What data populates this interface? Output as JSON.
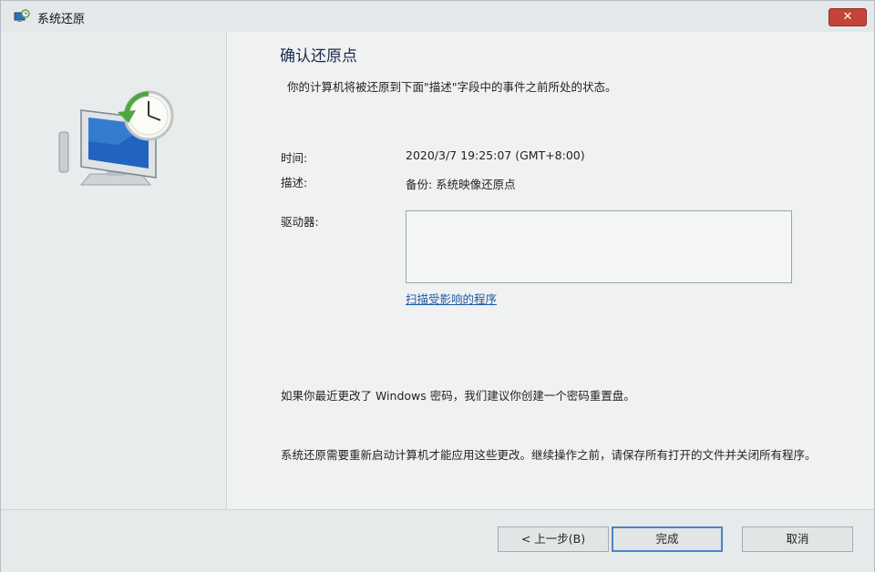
{
  "window": {
    "title": "系统还原",
    "close_label": "✕"
  },
  "main": {
    "heading": "确认还原点",
    "intro": "你的计算机将被还原到下面\"描述\"字段中的事件之前所处的状态。",
    "time_label": "时间:",
    "time_value": "2020/3/7 19:25:07 (GMT+8:00)",
    "description_label": "描述:",
    "description_value": "备份: 系统映像还原点",
    "drives_label": "驱动器:",
    "scan_link": "扫描受影响的程序",
    "password_note": "如果你最近更改了 Windows 密码，我们建议你创建一个密码重置盘。",
    "restart_note": "系统还原需要重新启动计算机才能应用这些更改。继续操作之前，请保存所有打开的文件并关闭所有程序。"
  },
  "footer": {
    "back_label": "< 上一步(B)",
    "finish_label": "完成",
    "cancel_label": "取消"
  },
  "colors": {
    "heading": "#1b2a52",
    "link": "#1e5ba8",
    "close": "#c5443a",
    "primary_border": "#4b83c4"
  },
  "icons": {
    "title": "system-restore-icon",
    "hero": "system-restore-monitor-clock-icon"
  }
}
